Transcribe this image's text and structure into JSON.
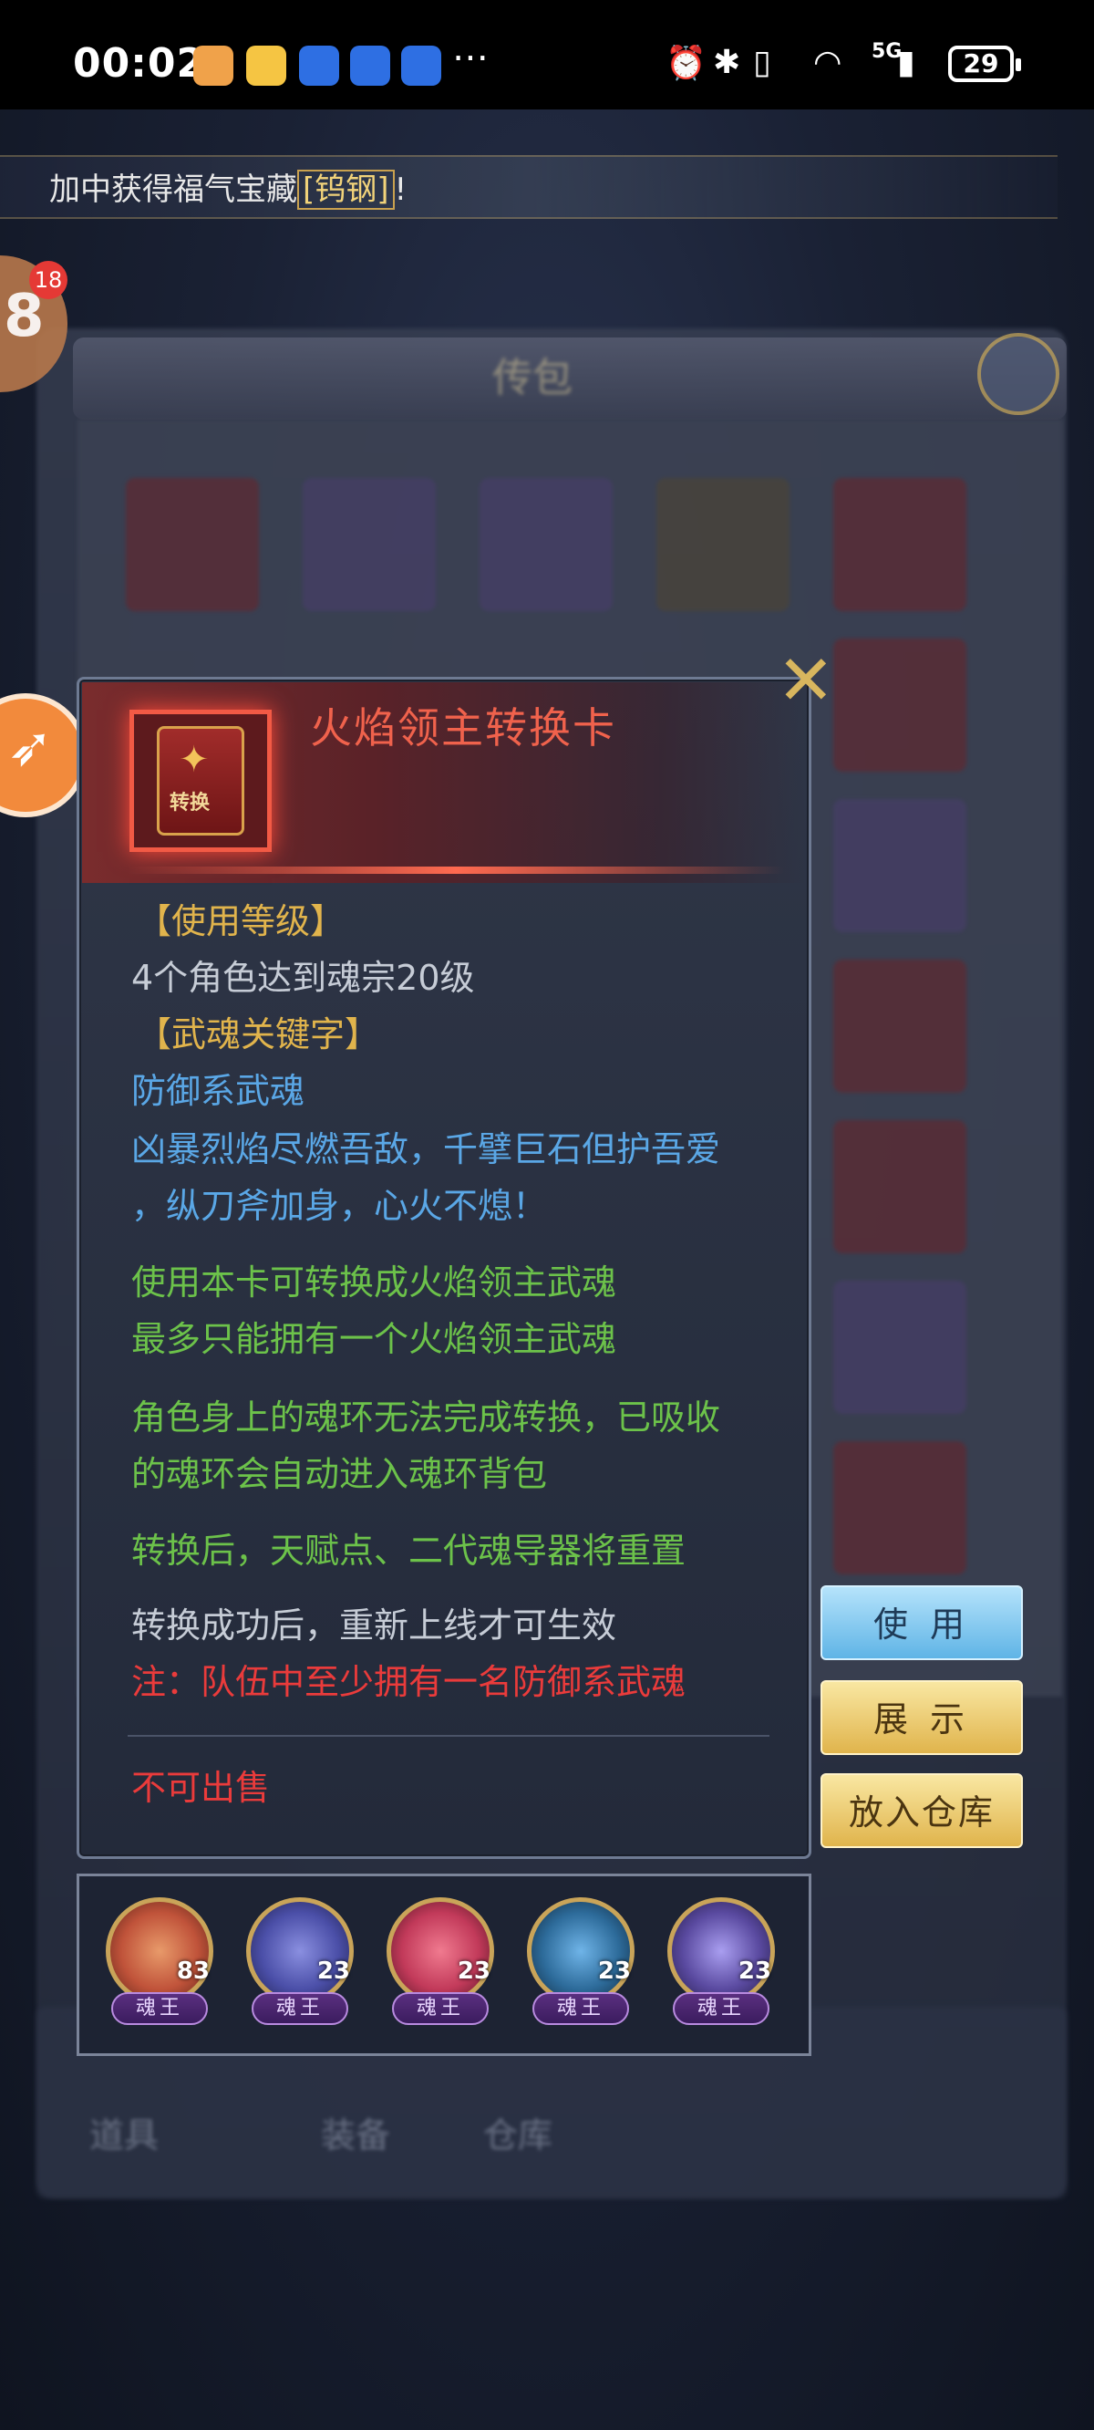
{
  "status_bar": {
    "time": "00:02",
    "network": "5G",
    "battery": "29"
  },
  "ticker": {
    "text_prefix": "加中获得福气宝藏",
    "highlight": "[钨钢]",
    "text_suffix": "!"
  },
  "notification": {
    "badge_digit": "8",
    "count": "18"
  },
  "bag": {
    "title": "传包",
    "tabs": [
      "道具",
      "装备",
      "仓库"
    ]
  },
  "item": {
    "name": "火焰领主转换卡",
    "card_label": "转换",
    "sections": {
      "level_heading": "【使用等级】",
      "level_req": "4个角色达到魂宗20级",
      "keyword_heading": "【武魂关键字】",
      "keyword_type": "防御系武魂",
      "flavor_line1": "凶暴烈焰尽燃吾敌，千擘巨石但护吾爱",
      "flavor_line2": "，纵刀斧加身，心火不熄！",
      "effect_line1": "使用本卡可转换成火焰领主武魂",
      "effect_line2": "最多只能拥有一个火焰领主武魂",
      "ring_line1": "角色身上的魂环无法完成转换，已吸收",
      "ring_line2": "的魂环会自动进入魂环背包",
      "reset_line": "转换后，天赋点、二代魂导器将重置",
      "relog_line": "转换成功后，重新上线才可生效",
      "note_line": "注：队伍中至少拥有一名防御系武魂",
      "sell_line": "不可出售"
    }
  },
  "buttons": {
    "use": "使 用",
    "show": "展 示",
    "store": "放入仓库"
  },
  "roles": [
    {
      "level": "83",
      "rank": "魂王",
      "color": "#c0533a"
    },
    {
      "level": "23",
      "rank": "魂王",
      "color": "#4b4fa8"
    },
    {
      "level": "23",
      "rank": "魂王",
      "color": "#c23a5a"
    },
    {
      "level": "23",
      "rank": "魂王",
      "color": "#2d6b9a"
    },
    {
      "level": "23",
      "rank": "魂王",
      "color": "#5a4aa0"
    }
  ],
  "colors": {
    "item_name": "#f0624c",
    "heading_gold": "#e1b44c",
    "flavor_blue": "#5aa7e6",
    "effect_green": "#6cc24a",
    "warning_red": "#ea3b3b"
  }
}
